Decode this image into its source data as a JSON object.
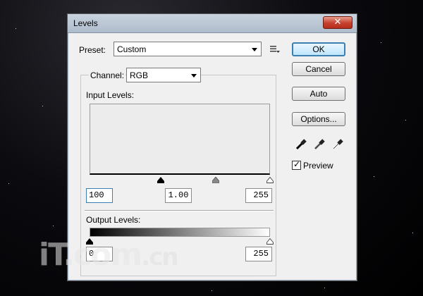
{
  "dialog": {
    "title": "Levels",
    "close_glyph": "✕"
  },
  "preset": {
    "label": "Preset:",
    "value": "Custom",
    "menu_icon": "preset-options-icon"
  },
  "channel": {
    "label": "Channel:",
    "value": "RGB"
  },
  "input_levels": {
    "label": "Input Levels:",
    "black": "100",
    "gamma": "1.00",
    "white": "255"
  },
  "output_levels": {
    "label": "Output Levels:",
    "black": "0",
    "white": "255"
  },
  "buttons": {
    "ok": "OK",
    "cancel": "Cancel",
    "auto": "Auto",
    "options": "Options..."
  },
  "eyedroppers": [
    "black-point-eyedropper-icon",
    "gray-point-eyedropper-icon",
    "white-point-eyedropper-icon"
  ],
  "preview": {
    "label": "Preview",
    "checked": true,
    "mark": "✓"
  },
  "watermark": {
    "text_main": "iT.com",
    "text_suffix": ".cn"
  }
}
